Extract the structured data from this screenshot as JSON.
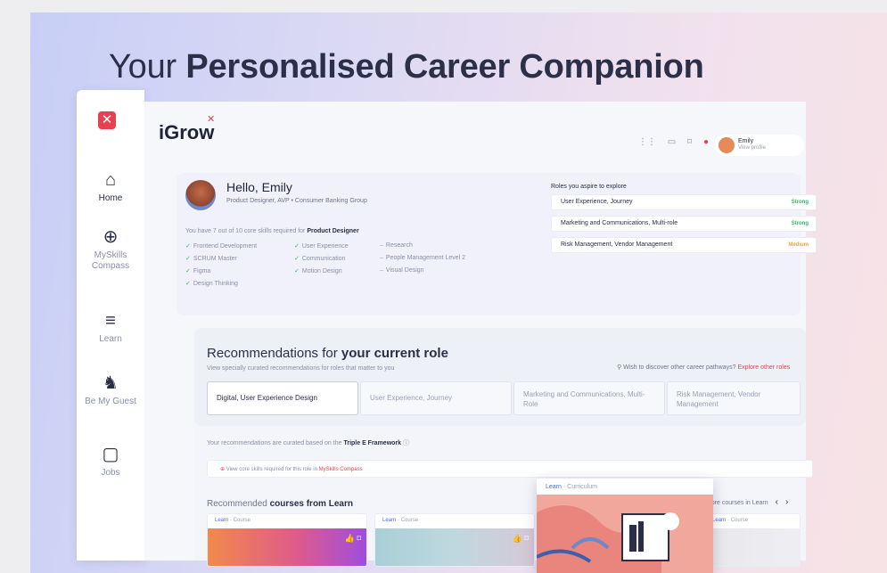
{
  "headline": {
    "regular": "Your ",
    "bold": "Personalised Career Companion"
  },
  "sidebar": {
    "items": [
      {
        "label": "Home",
        "icon": "home-icon",
        "glyph": "⌂"
      },
      {
        "label": "MySkills Compass",
        "icon": "compass-icon",
        "glyph": "⊕"
      },
      {
        "label": "Learn",
        "icon": "library-icon",
        "glyph": "≡"
      },
      {
        "label": "Be My Guest",
        "icon": "runner-icon",
        "glyph": "♞"
      },
      {
        "label": "Jobs",
        "icon": "briefcase-icon",
        "glyph": "▢"
      }
    ]
  },
  "topbar": {
    "brand": "iGrow",
    "user_name": "Emily",
    "user_sub": "View profile"
  },
  "hello": {
    "title": "Hello, Emily",
    "subtitle": "Product Designer, AVP • Consumer Banking Group",
    "skills_intro_prefix": "You have 7 out of 10 core skills required for ",
    "skills_intro_role": "Product Designer",
    "skills": [
      {
        "name": "Frontend Development",
        "has": true
      },
      {
        "name": "SCRUM Master",
        "has": true
      },
      {
        "name": "Figma",
        "has": true
      },
      {
        "name": "Design Thinking",
        "has": true
      },
      {
        "name": "User Experience",
        "has": true
      },
      {
        "name": "Communication",
        "has": true
      },
      {
        "name": "Motion Design",
        "has": true
      },
      {
        "name": "Research",
        "has": false
      },
      {
        "name": "People Management Level 2",
        "has": false
      },
      {
        "name": "Visual Design",
        "has": false
      }
    ]
  },
  "roles": {
    "title": "Roles you aspire to explore",
    "items": [
      {
        "name": "User Experience, Journey",
        "badge": "Strong",
        "color": "#3cb371"
      },
      {
        "name": "Marketing and Communications, Multi-role",
        "badge": "Strong",
        "color": "#3cb371"
      },
      {
        "name": "Risk Management, Vendor Management",
        "badge": "Medium",
        "color": "#f0a830"
      }
    ]
  },
  "recommendations": {
    "title_regular": "Recommendations for ",
    "title_bold": "your current role",
    "subtitle": "View specially curated recommendations for roles that matter to you",
    "wish_text": "Wish to discover other career pathways? ",
    "wish_link": "Explore other roles",
    "tabs": [
      {
        "label": "Digital, User Experience Design"
      },
      {
        "label": "User Experience, Journey"
      },
      {
        "label": "Marketing and Communications, Multi-Role"
      },
      {
        "label": "Risk Management, Vendor Management"
      }
    ]
  },
  "curation": {
    "text": "Your recommendations are curated based on the ",
    "framework": "Triple E Framework",
    "notice_text": "View core skills required for this role in ",
    "notice_link": "MySkills Compass"
  },
  "courses": {
    "title_regular": "Recommended ",
    "title_bold": "courses from Learn",
    "more": "more courses in Learn",
    "cards": [
      {
        "tag": "Learn",
        "type": "Course"
      },
      {
        "tag": "Learn",
        "type": "Course"
      },
      {
        "tag": "Learn",
        "type": "Course"
      }
    ],
    "popup": {
      "tag": "Learn",
      "type": "Curriculum"
    }
  },
  "colors": {
    "accent": "#e64150",
    "link": "#4a6de0",
    "strong": "#3cb371",
    "medium": "#f0a830"
  }
}
